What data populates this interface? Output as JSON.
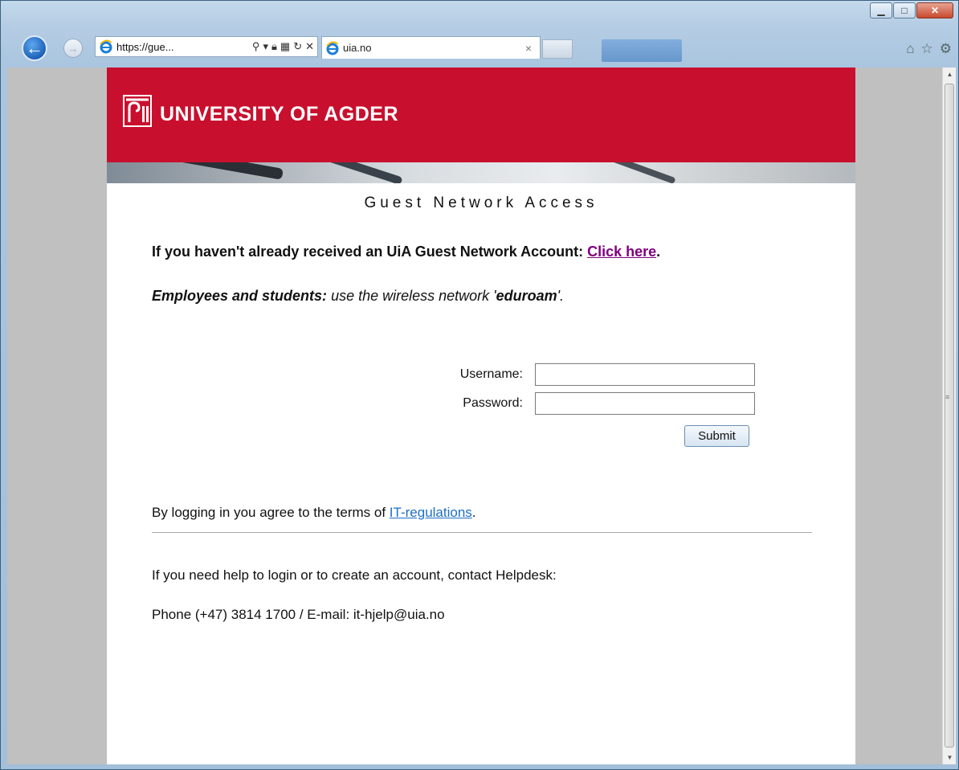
{
  "browser": {
    "url": "https://gue...",
    "tab_title": "uia.no",
    "tab_close": "×"
  },
  "banner": {
    "university_name": "UNIVERSITY OF AGDER",
    "brand_color": "#c8102e"
  },
  "page": {
    "title": "Guest Network Access",
    "account_prompt": "If you haven't already received an UiA Guest Network Account: ",
    "account_link": "Click here",
    "account_suffix": ".",
    "employees_label": "Employees and students:",
    "employees_text": " use the wireless network '",
    "network_name": "eduroam",
    "employees_end": "'."
  },
  "login_form": {
    "username_label": "Username:",
    "username_value": "",
    "password_label": "Password:",
    "password_value": "",
    "submit_label": "Submit"
  },
  "footer": {
    "terms_text": "By logging in you agree to the terms of ",
    "terms_link": "IT-regulations",
    "terms_end": ".",
    "help_text": "If you need help to login or to create an account, contact Helpdesk:",
    "contact_text": "Phone (+47) 3814 1700 / E-mail: it-hjelp@uia.no"
  },
  "icons": [
    "back-arrow-icon",
    "forward-arrow-icon",
    "ie-logo-icon",
    "search-icon",
    "lock-icon",
    "compat-view-icon",
    "refresh-icon",
    "stop-icon",
    "home-icon",
    "favorites-star-icon",
    "gear-icon",
    "minimize-icon",
    "maximize-icon",
    "close-icon"
  ]
}
